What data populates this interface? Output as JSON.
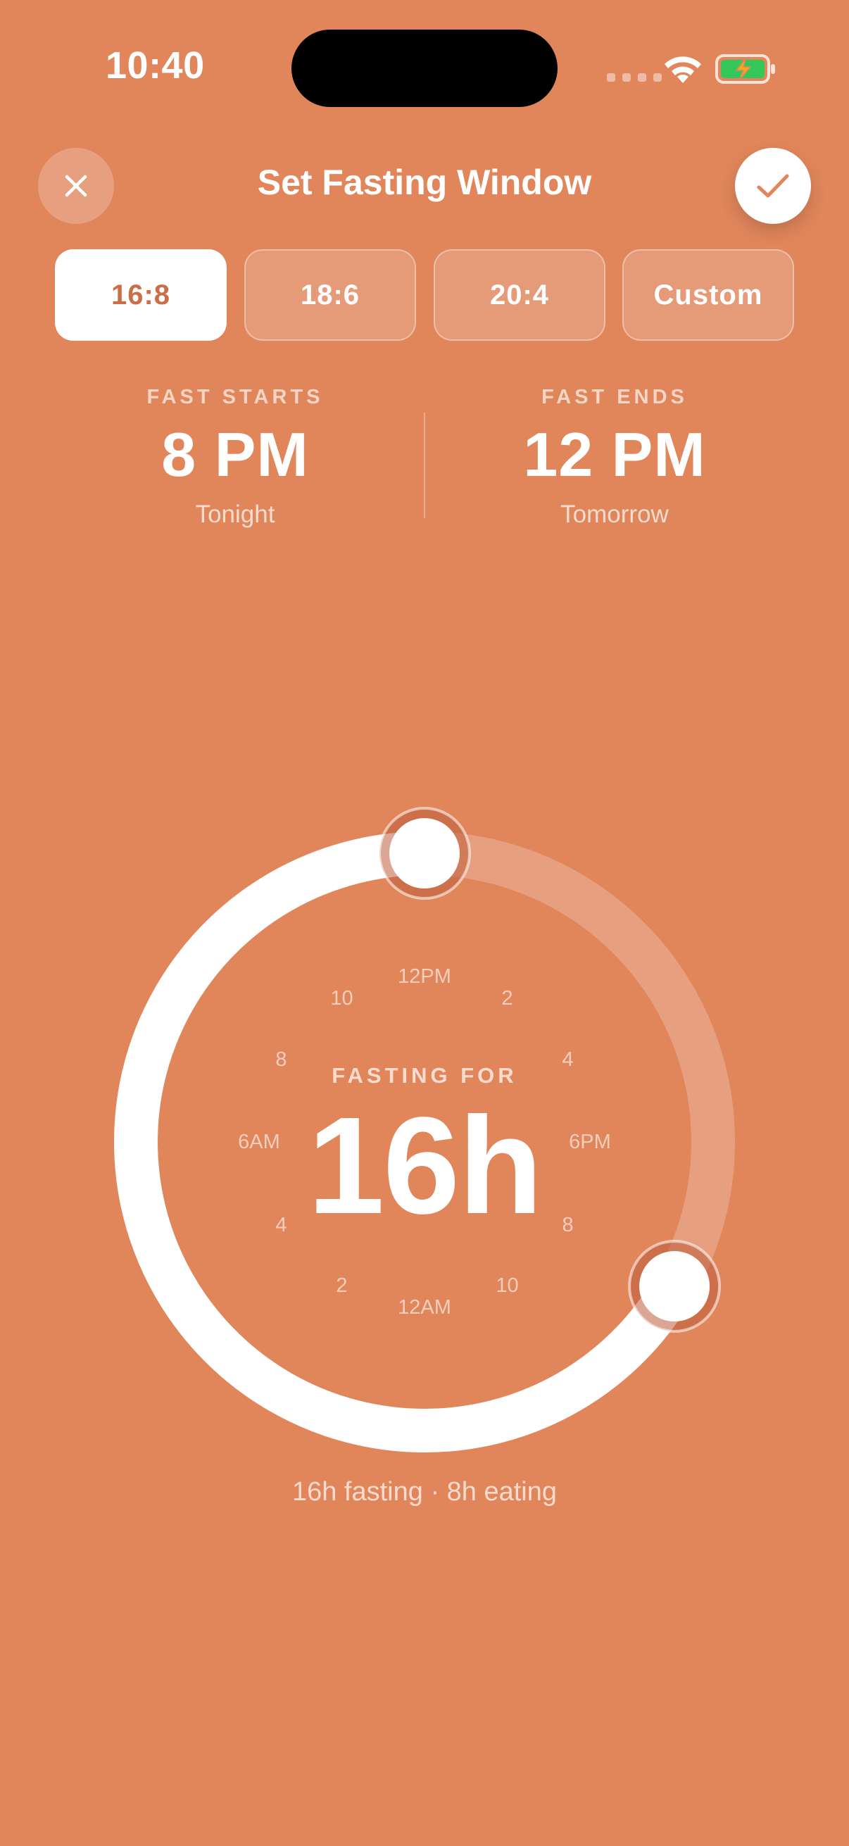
{
  "status_bar": {
    "time": "10:40"
  },
  "header": {
    "title": "Set Fasting Window",
    "close_icon": "close-icon",
    "confirm_icon": "checkmark-icon"
  },
  "presets": [
    {
      "label": "16:8",
      "selected": true
    },
    {
      "label": "18:6",
      "selected": false
    },
    {
      "label": "20:4",
      "selected": false
    },
    {
      "label": "Custom",
      "selected": false
    }
  ],
  "summary": {
    "start": {
      "label": "FAST STARTS",
      "time": "8 PM",
      "day": "Tonight"
    },
    "end": {
      "label": "FAST ENDS",
      "time": "12 PM",
      "day": "Tomorrow"
    }
  },
  "dial": {
    "center_label": "FASTING FOR",
    "center_value": "16h",
    "fast_start_hour": 20,
    "fast_end_hour": 12,
    "hour_labels": [
      {
        "hour": 0,
        "text": "12AM"
      },
      {
        "hour": 2,
        "text": "2"
      },
      {
        "hour": 4,
        "text": "4"
      },
      {
        "hour": 6,
        "text": "6AM"
      },
      {
        "hour": 8,
        "text": "8"
      },
      {
        "hour": 10,
        "text": "10"
      },
      {
        "hour": 12,
        "text": "12PM"
      },
      {
        "hour": 14,
        "text": "2"
      },
      {
        "hour": 16,
        "text": "4"
      },
      {
        "hour": 18,
        "text": "6PM"
      },
      {
        "hour": 20,
        "text": "8"
      },
      {
        "hour": 22,
        "text": "10"
      }
    ]
  },
  "footer": {
    "text": "16h fasting · 8h eating"
  },
  "colors": {
    "background": "#E1865B",
    "accent_text": "#C96E45",
    "battery_fill": "#34C759",
    "battery_bolt": "#F5A623"
  }
}
